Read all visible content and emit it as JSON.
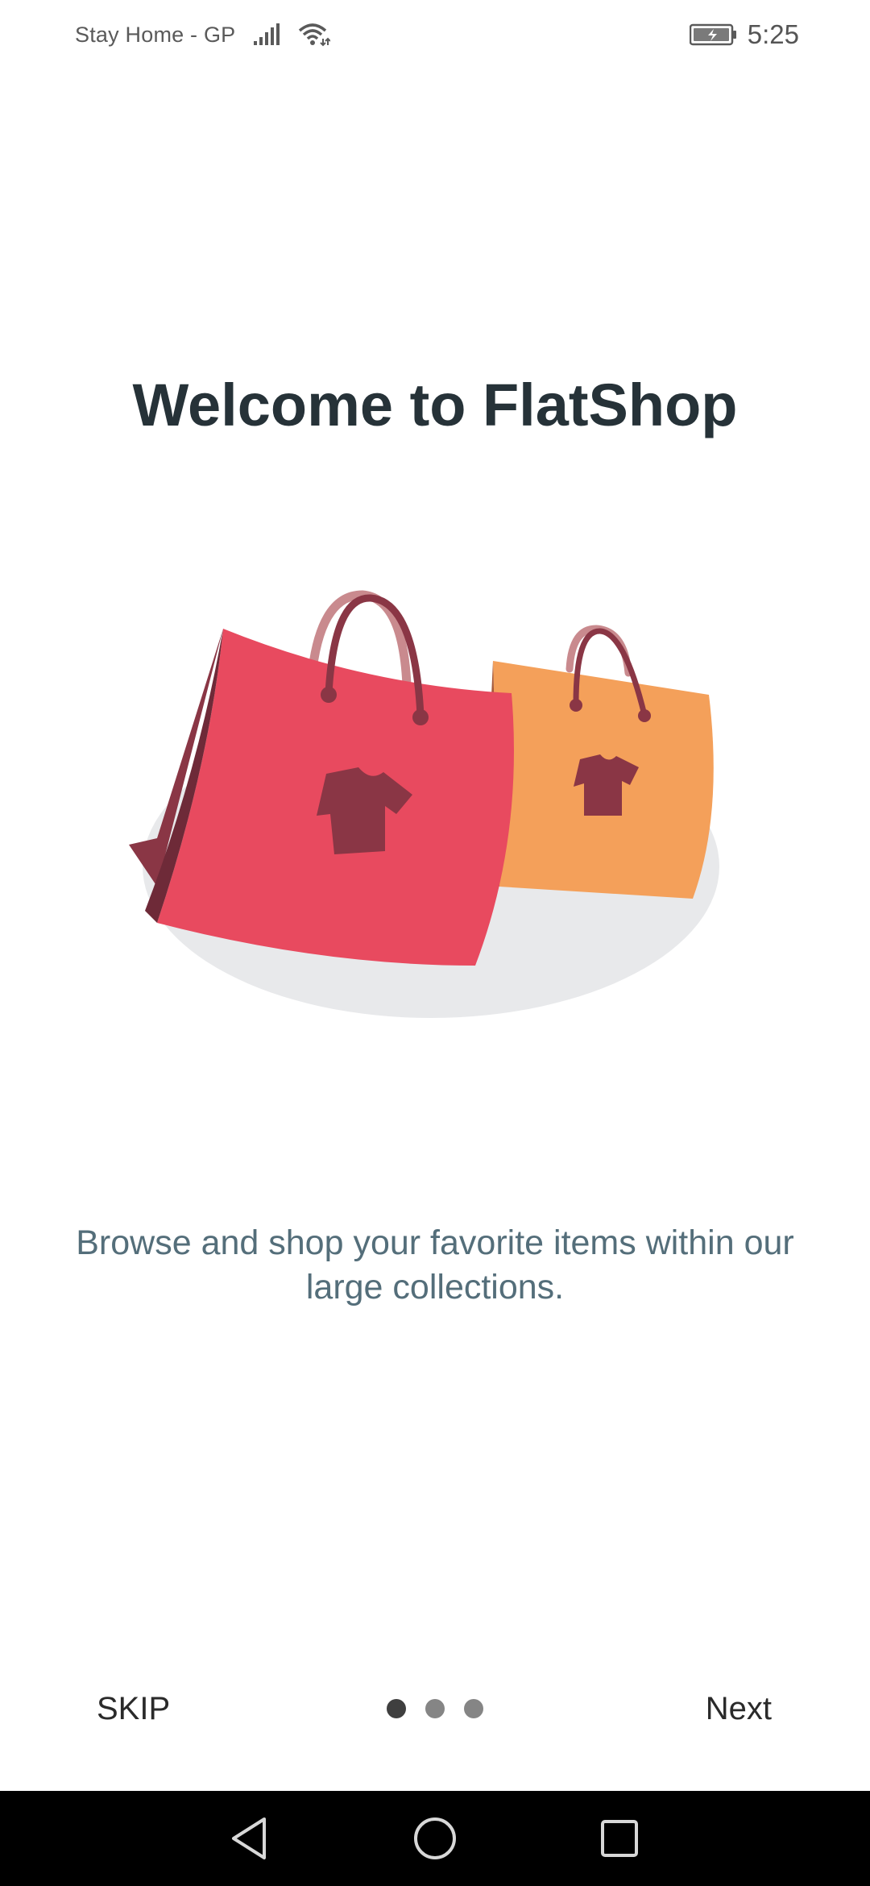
{
  "status_bar": {
    "carrier": "Stay Home - GP",
    "time": "5:25",
    "icons": [
      "signal-icon",
      "wifi-icon",
      "battery-charging-icon"
    ]
  },
  "onboarding": {
    "title": "Welcome to FlatShop",
    "description": "Browse and shop your favorite items within our large collections.",
    "illustration": "shopping-bags-illustration",
    "skip_label": "SKIP",
    "next_label": "Next",
    "page_indicator": {
      "current": 1,
      "total": 3
    }
  },
  "colors": {
    "title": "#263238",
    "description": "#546e7a",
    "red_bag": "#e84a5f",
    "orange_bag": "#f4a05a",
    "shirt": "#8a3645",
    "shadow": "#e8e9eb"
  },
  "nav_bar": {
    "buttons": [
      "back-icon",
      "home-icon",
      "recent-apps-icon"
    ]
  }
}
